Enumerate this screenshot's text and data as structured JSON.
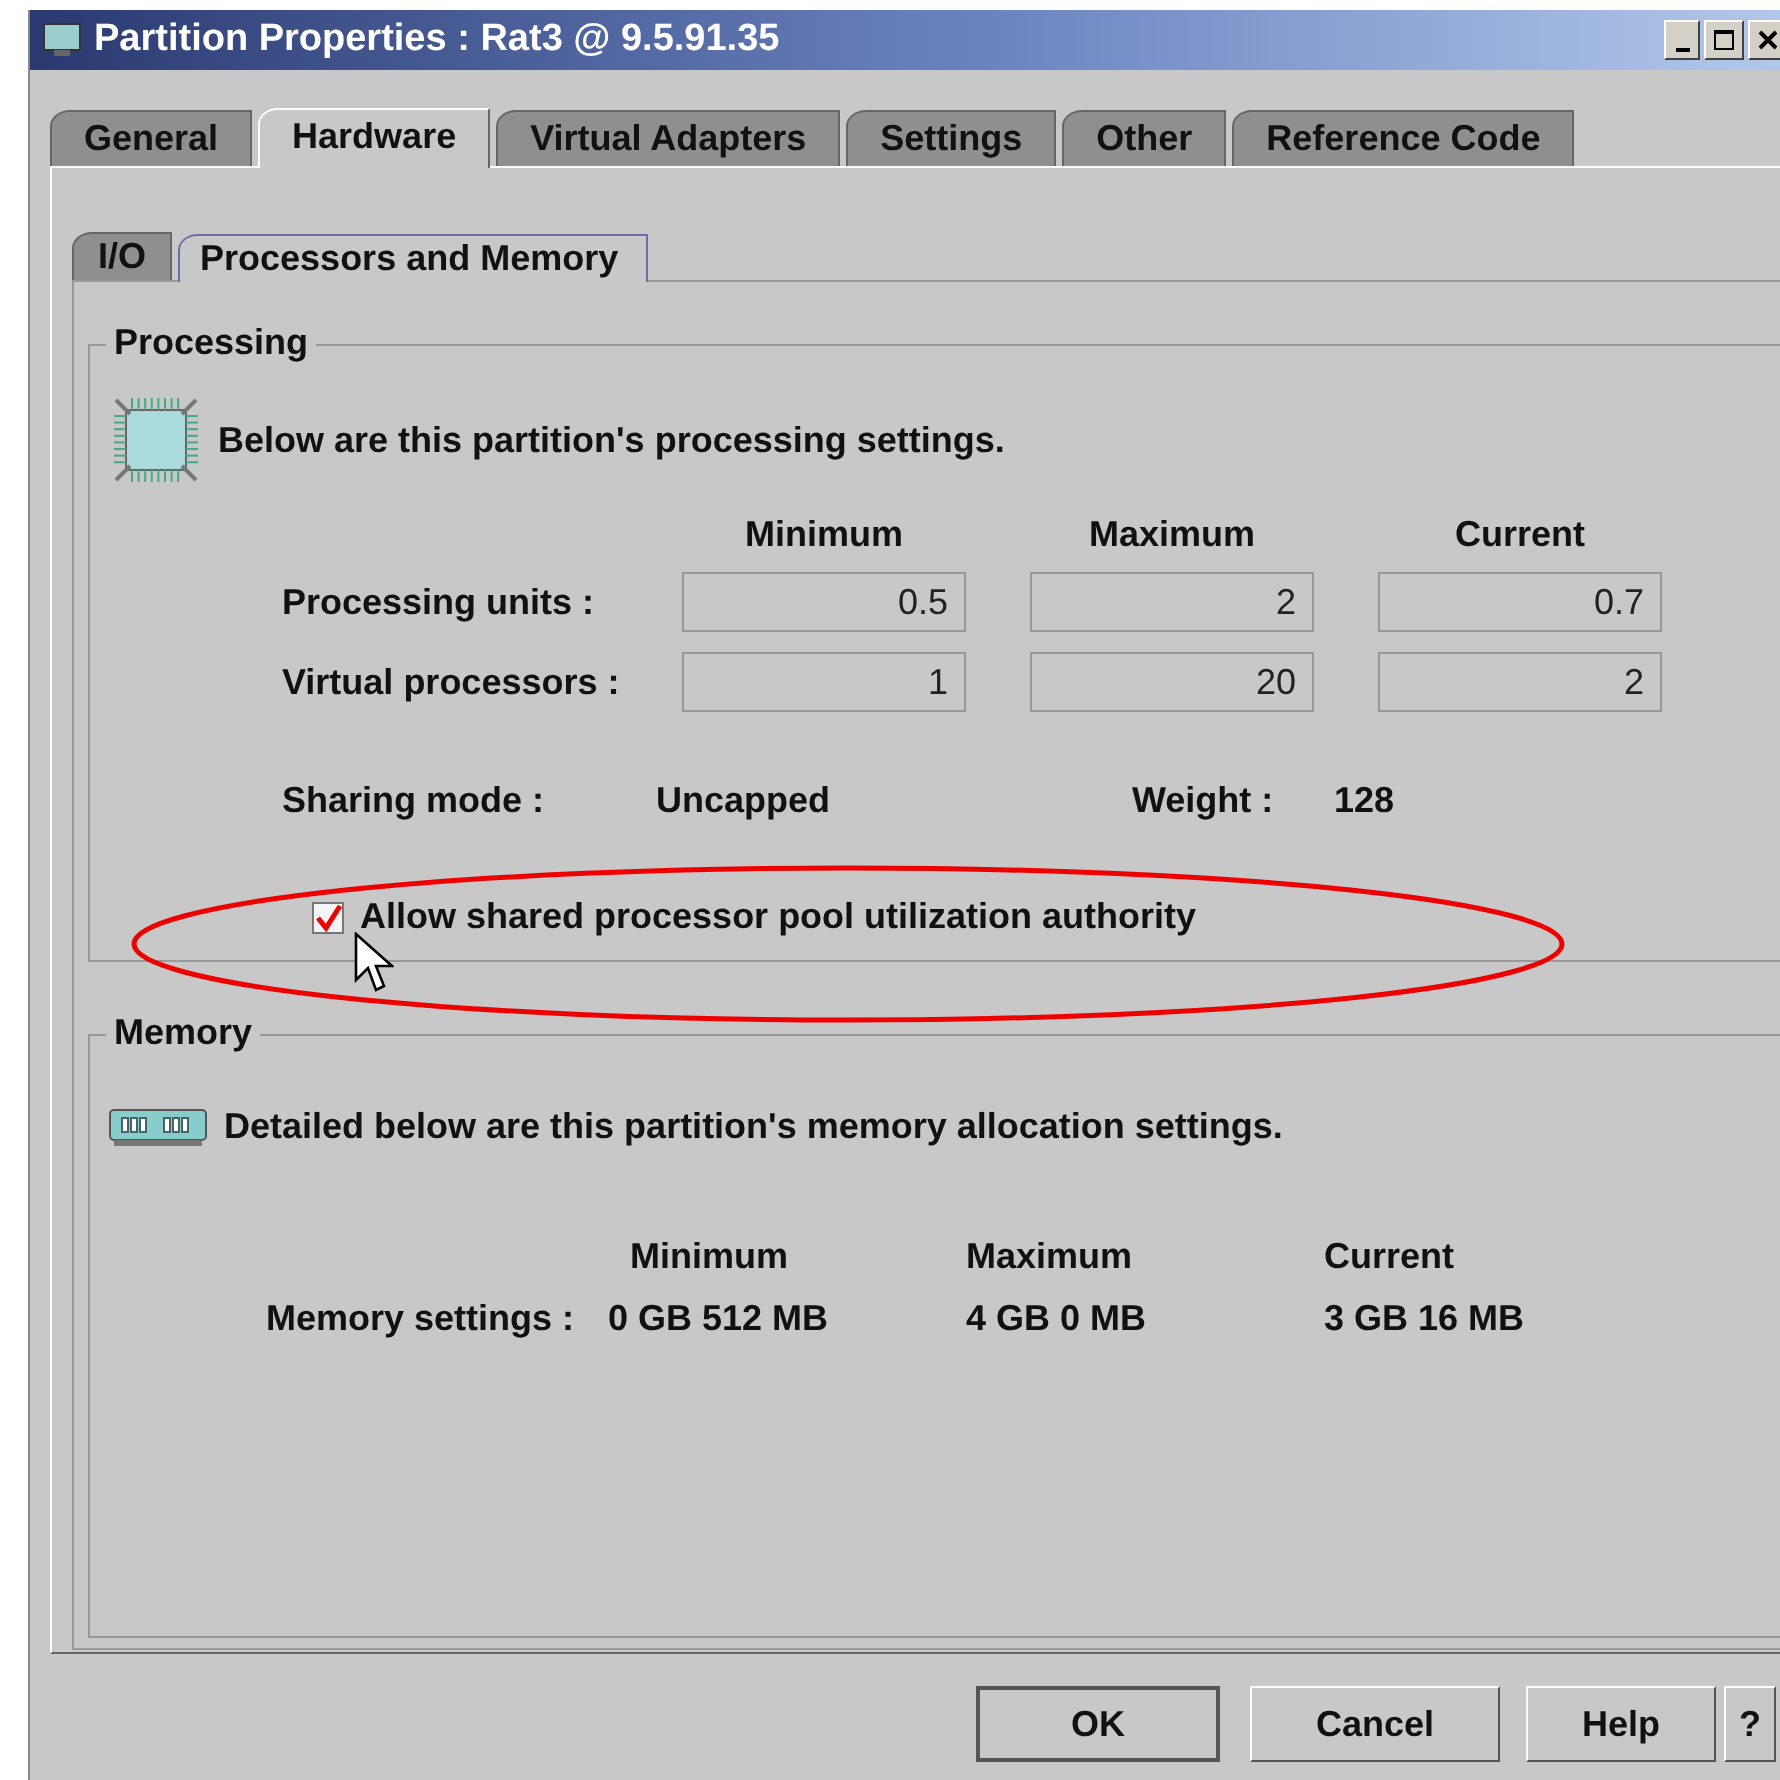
{
  "window": {
    "title": "Partition Properties : Rat3 @ 9.5.91.35"
  },
  "tabs": [
    {
      "label": "General",
      "selected": false
    },
    {
      "label": "Hardware",
      "selected": true
    },
    {
      "label": "Virtual Adapters",
      "selected": false
    },
    {
      "label": "Settings",
      "selected": false
    },
    {
      "label": "Other",
      "selected": false
    },
    {
      "label": "Reference Code",
      "selected": false
    }
  ],
  "subtabs": [
    {
      "label": "I/O",
      "selected": false
    },
    {
      "label": "Processors and Memory",
      "selected": true
    }
  ],
  "processing": {
    "title": "Processing",
    "description": "Below are this partition's processing settings.",
    "columns": [
      "Minimum",
      "Maximum",
      "Current"
    ],
    "rows": [
      {
        "label": "Processing units :",
        "values": [
          "0.5",
          "2",
          "0.7"
        ]
      },
      {
        "label": "Virtual processors :",
        "values": [
          "1",
          "20",
          "2"
        ]
      }
    ],
    "sharing_mode_label": "Sharing mode :",
    "sharing_mode": "Uncapped",
    "weight_label": "Weight :",
    "weight": "128",
    "checkbox": {
      "label": "Allow shared processor pool utilization authority",
      "checked": true
    }
  },
  "memory": {
    "title": "Memory",
    "description": "Detailed below are this partition's memory allocation settings.",
    "columns": [
      "Minimum",
      "Maximum",
      "Current"
    ],
    "row": {
      "label": "Memory settings :",
      "values": [
        "0 GB 512 MB",
        "4 GB 0 MB",
        "3 GB 16 MB"
      ]
    }
  },
  "buttons": [
    {
      "label": "OK",
      "default": true
    },
    {
      "label": "Cancel",
      "default": false
    },
    {
      "label": "Help",
      "default": false
    },
    {
      "label": "?",
      "default": false
    }
  ]
}
